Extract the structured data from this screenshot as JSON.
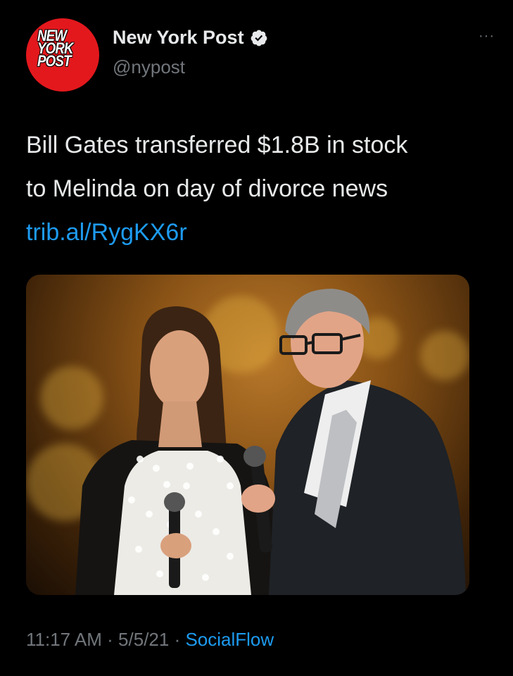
{
  "account": {
    "display_name": "New York Post",
    "handle": "@nypost",
    "avatar_logo_lines": [
      "NEW",
      "YORK",
      "POST"
    ]
  },
  "tweet": {
    "text_line1": "Bill Gates transferred $1.8B in stock",
    "text_line2": "to Melinda on day of divorce news",
    "link": "trib.al/RygKX6r",
    "time": "11:17 AM",
    "date": "5/5/21",
    "source": "SocialFlow",
    "separator": " · "
  },
  "ui": {
    "more_label": "···"
  },
  "colors": {
    "background": "#000000",
    "text": "#e7e9ea",
    "secondary": "#71767b",
    "link": "#1d9bf0",
    "brand_red": "#e3181d"
  },
  "icons": {
    "verified": "verified-badge-icon",
    "more": "more-options-icon"
  }
}
